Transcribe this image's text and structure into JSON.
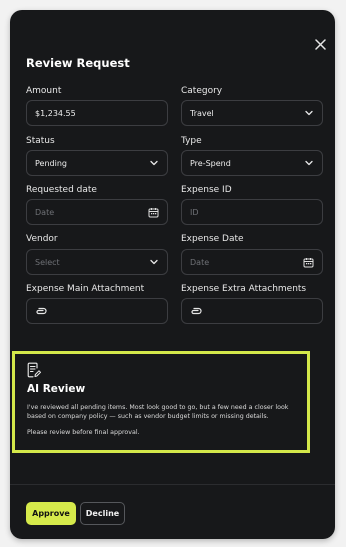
{
  "modal": {
    "title": "Review Request",
    "close_icon": "close-icon"
  },
  "form": {
    "amount": {
      "label": "Amount",
      "value": "$1,234.55"
    },
    "category": {
      "label": "Category",
      "value": "Travel"
    },
    "status": {
      "label": "Status",
      "value": "Pending"
    },
    "type": {
      "label": "Type",
      "value": "Pre-Spend"
    },
    "requested_date": {
      "label": "Requested date",
      "placeholder": "Date"
    },
    "expense_id": {
      "label": "Expense ID",
      "placeholder": "ID"
    },
    "vendor": {
      "label": "Vendor",
      "placeholder": "Select"
    },
    "expense_date": {
      "label": "Expense Date",
      "placeholder": "Date"
    },
    "main_attachment": {
      "label": "Expense Main Attachment"
    },
    "extra_attachments": {
      "label": "Expense Extra Attachments"
    }
  },
  "ai_review": {
    "title": "AI Review",
    "body": "I've reviewed all pending items. Most look good to go, but a few need a closer look based on company policy — such as vendor budget limits or missing details.",
    "footer_note": "Please review before final approval.",
    "highlight_color": "#d4e84a"
  },
  "actions": {
    "approve_label": "Approve",
    "decline_label": "Decline",
    "accent_color": "#d6ea4b"
  }
}
